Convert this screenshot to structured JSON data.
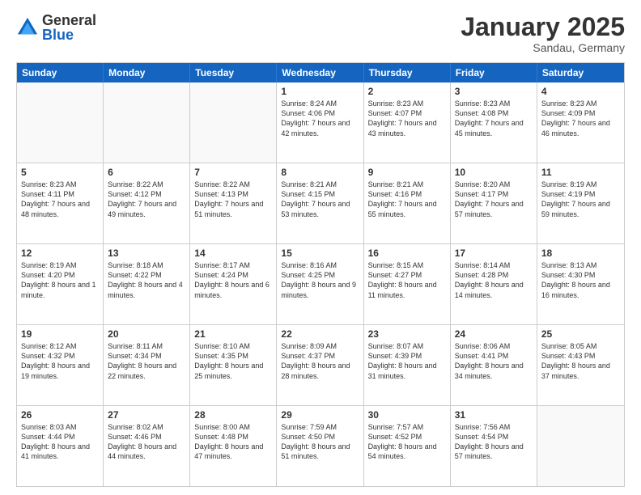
{
  "logo": {
    "general": "General",
    "blue": "Blue"
  },
  "title": "January 2025",
  "subtitle": "Sandau, Germany",
  "days_of_week": [
    "Sunday",
    "Monday",
    "Tuesday",
    "Wednesday",
    "Thursday",
    "Friday",
    "Saturday"
  ],
  "weeks": [
    [
      {
        "day": "",
        "sunrise": "",
        "sunset": "",
        "daylight": "",
        "empty": true
      },
      {
        "day": "",
        "sunrise": "",
        "sunset": "",
        "daylight": "",
        "empty": true
      },
      {
        "day": "",
        "sunrise": "",
        "sunset": "",
        "daylight": "",
        "empty": true
      },
      {
        "day": "1",
        "sunrise": "Sunrise: 8:24 AM",
        "sunset": "Sunset: 4:06 PM",
        "daylight": "Daylight: 7 hours and 42 minutes.",
        "empty": false
      },
      {
        "day": "2",
        "sunrise": "Sunrise: 8:23 AM",
        "sunset": "Sunset: 4:07 PM",
        "daylight": "Daylight: 7 hours and 43 minutes.",
        "empty": false
      },
      {
        "day": "3",
        "sunrise": "Sunrise: 8:23 AM",
        "sunset": "Sunset: 4:08 PM",
        "daylight": "Daylight: 7 hours and 45 minutes.",
        "empty": false
      },
      {
        "day": "4",
        "sunrise": "Sunrise: 8:23 AM",
        "sunset": "Sunset: 4:09 PM",
        "daylight": "Daylight: 7 hours and 46 minutes.",
        "empty": false
      }
    ],
    [
      {
        "day": "5",
        "sunrise": "Sunrise: 8:23 AM",
        "sunset": "Sunset: 4:11 PM",
        "daylight": "Daylight: 7 hours and 48 minutes.",
        "empty": false
      },
      {
        "day": "6",
        "sunrise": "Sunrise: 8:22 AM",
        "sunset": "Sunset: 4:12 PM",
        "daylight": "Daylight: 7 hours and 49 minutes.",
        "empty": false
      },
      {
        "day": "7",
        "sunrise": "Sunrise: 8:22 AM",
        "sunset": "Sunset: 4:13 PM",
        "daylight": "Daylight: 7 hours and 51 minutes.",
        "empty": false
      },
      {
        "day": "8",
        "sunrise": "Sunrise: 8:21 AM",
        "sunset": "Sunset: 4:15 PM",
        "daylight": "Daylight: 7 hours and 53 minutes.",
        "empty": false
      },
      {
        "day": "9",
        "sunrise": "Sunrise: 8:21 AM",
        "sunset": "Sunset: 4:16 PM",
        "daylight": "Daylight: 7 hours and 55 minutes.",
        "empty": false
      },
      {
        "day": "10",
        "sunrise": "Sunrise: 8:20 AM",
        "sunset": "Sunset: 4:17 PM",
        "daylight": "Daylight: 7 hours and 57 minutes.",
        "empty": false
      },
      {
        "day": "11",
        "sunrise": "Sunrise: 8:19 AM",
        "sunset": "Sunset: 4:19 PM",
        "daylight": "Daylight: 7 hours and 59 minutes.",
        "empty": false
      }
    ],
    [
      {
        "day": "12",
        "sunrise": "Sunrise: 8:19 AM",
        "sunset": "Sunset: 4:20 PM",
        "daylight": "Daylight: 8 hours and 1 minute.",
        "empty": false
      },
      {
        "day": "13",
        "sunrise": "Sunrise: 8:18 AM",
        "sunset": "Sunset: 4:22 PM",
        "daylight": "Daylight: 8 hours and 4 minutes.",
        "empty": false
      },
      {
        "day": "14",
        "sunrise": "Sunrise: 8:17 AM",
        "sunset": "Sunset: 4:24 PM",
        "daylight": "Daylight: 8 hours and 6 minutes.",
        "empty": false
      },
      {
        "day": "15",
        "sunrise": "Sunrise: 8:16 AM",
        "sunset": "Sunset: 4:25 PM",
        "daylight": "Daylight: 8 hours and 9 minutes.",
        "empty": false
      },
      {
        "day": "16",
        "sunrise": "Sunrise: 8:15 AM",
        "sunset": "Sunset: 4:27 PM",
        "daylight": "Daylight: 8 hours and 11 minutes.",
        "empty": false
      },
      {
        "day": "17",
        "sunrise": "Sunrise: 8:14 AM",
        "sunset": "Sunset: 4:28 PM",
        "daylight": "Daylight: 8 hours and 14 minutes.",
        "empty": false
      },
      {
        "day": "18",
        "sunrise": "Sunrise: 8:13 AM",
        "sunset": "Sunset: 4:30 PM",
        "daylight": "Daylight: 8 hours and 16 minutes.",
        "empty": false
      }
    ],
    [
      {
        "day": "19",
        "sunrise": "Sunrise: 8:12 AM",
        "sunset": "Sunset: 4:32 PM",
        "daylight": "Daylight: 8 hours and 19 minutes.",
        "empty": false
      },
      {
        "day": "20",
        "sunrise": "Sunrise: 8:11 AM",
        "sunset": "Sunset: 4:34 PM",
        "daylight": "Daylight: 8 hours and 22 minutes.",
        "empty": false
      },
      {
        "day": "21",
        "sunrise": "Sunrise: 8:10 AM",
        "sunset": "Sunset: 4:35 PM",
        "daylight": "Daylight: 8 hours and 25 minutes.",
        "empty": false
      },
      {
        "day": "22",
        "sunrise": "Sunrise: 8:09 AM",
        "sunset": "Sunset: 4:37 PM",
        "daylight": "Daylight: 8 hours and 28 minutes.",
        "empty": false
      },
      {
        "day": "23",
        "sunrise": "Sunrise: 8:07 AM",
        "sunset": "Sunset: 4:39 PM",
        "daylight": "Daylight: 8 hours and 31 minutes.",
        "empty": false
      },
      {
        "day": "24",
        "sunrise": "Sunrise: 8:06 AM",
        "sunset": "Sunset: 4:41 PM",
        "daylight": "Daylight: 8 hours and 34 minutes.",
        "empty": false
      },
      {
        "day": "25",
        "sunrise": "Sunrise: 8:05 AM",
        "sunset": "Sunset: 4:43 PM",
        "daylight": "Daylight: 8 hours and 37 minutes.",
        "empty": false
      }
    ],
    [
      {
        "day": "26",
        "sunrise": "Sunrise: 8:03 AM",
        "sunset": "Sunset: 4:44 PM",
        "daylight": "Daylight: 8 hours and 41 minutes.",
        "empty": false
      },
      {
        "day": "27",
        "sunrise": "Sunrise: 8:02 AM",
        "sunset": "Sunset: 4:46 PM",
        "daylight": "Daylight: 8 hours and 44 minutes.",
        "empty": false
      },
      {
        "day": "28",
        "sunrise": "Sunrise: 8:00 AM",
        "sunset": "Sunset: 4:48 PM",
        "daylight": "Daylight: 8 hours and 47 minutes.",
        "empty": false
      },
      {
        "day": "29",
        "sunrise": "Sunrise: 7:59 AM",
        "sunset": "Sunset: 4:50 PM",
        "daylight": "Daylight: 8 hours and 51 minutes.",
        "empty": false
      },
      {
        "day": "30",
        "sunrise": "Sunrise: 7:57 AM",
        "sunset": "Sunset: 4:52 PM",
        "daylight": "Daylight: 8 hours and 54 minutes.",
        "empty": false
      },
      {
        "day": "31",
        "sunrise": "Sunrise: 7:56 AM",
        "sunset": "Sunset: 4:54 PM",
        "daylight": "Daylight: 8 hours and 57 minutes.",
        "empty": false
      },
      {
        "day": "",
        "sunrise": "",
        "sunset": "",
        "daylight": "",
        "empty": true
      }
    ]
  ]
}
